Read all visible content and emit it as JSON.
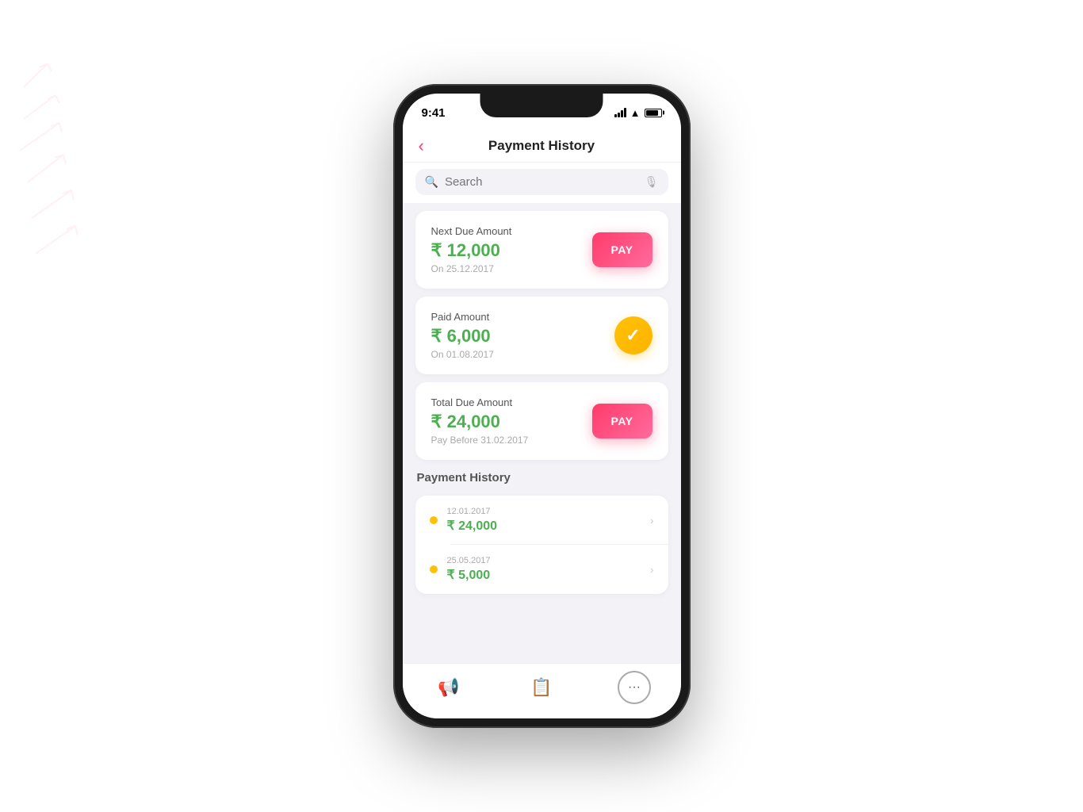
{
  "background": {
    "color": "#fff"
  },
  "phone": {
    "status_bar": {
      "time": "9:41",
      "icons": [
        "signal",
        "wifi",
        "battery"
      ]
    },
    "nav": {
      "title": "Payment History",
      "back_label": "‹"
    },
    "search": {
      "placeholder": "Search"
    },
    "cards": [
      {
        "id": "next-due",
        "label": "Next Due Amount",
        "amount": "₹ 12,000",
        "date": "On 25.12.2017",
        "action": "PAY",
        "action_type": "pay"
      },
      {
        "id": "paid-amount",
        "label": "Paid Amount",
        "amount": "₹ 6,000",
        "date": "On 01.08.2017",
        "action_type": "check"
      },
      {
        "id": "total-due",
        "label": "Total Due Amount",
        "amount": "₹ 24,000",
        "date": "Pay Before 31.02.2017",
        "action": "PAY",
        "action_type": "pay"
      }
    ],
    "history_section": {
      "title": "Payment History",
      "items": [
        {
          "date": "12.01.2017",
          "amount": "₹ 24,000"
        },
        {
          "date": "25.05.2017",
          "amount": "₹ 5,000"
        }
      ]
    },
    "tab_bar": {
      "items": [
        {
          "id": "announcements",
          "icon": "📢",
          "label": "Announcements"
        },
        {
          "id": "notes",
          "icon": "📋",
          "label": "Notes"
        },
        {
          "id": "more",
          "icon": "···",
          "label": "More",
          "active": true
        }
      ]
    }
  }
}
